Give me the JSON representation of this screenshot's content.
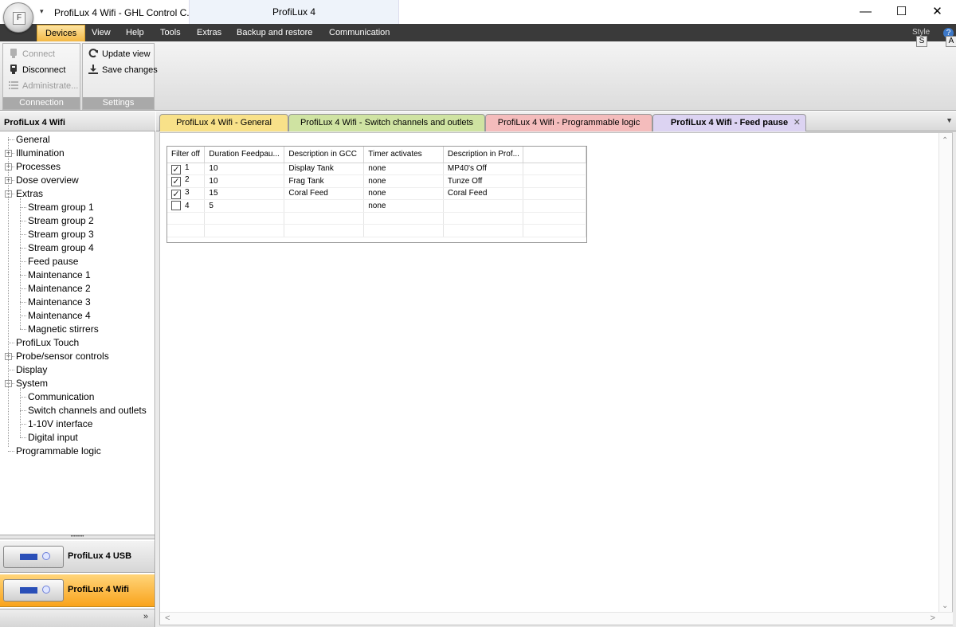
{
  "titlebar": {
    "orb_letter": "F",
    "left_title": "ProfiLux 4 Wifi - GHL Control C...",
    "center_title": "ProfiLux 4",
    "qat_arrow": "▾",
    "minimize": "—",
    "maximize": "☐",
    "close": "✕"
  },
  "menu": {
    "items": [
      "Devices",
      "View",
      "Help",
      "Tools",
      "Extras",
      "Backup and restore",
      "Communication"
    ],
    "active": "Devices",
    "style_label": "Style",
    "style_key": "S",
    "help_glyph": "?",
    "help_key": "A"
  },
  "ribbon": {
    "connection": {
      "label": "Connection",
      "buttons": [
        {
          "label": "Connect",
          "enabled": false,
          "icon": "plug-icon"
        },
        {
          "label": "Disconnect",
          "enabled": true,
          "icon": "unplug-icon"
        },
        {
          "label": "Administrate...",
          "enabled": false,
          "icon": "list-icon"
        }
      ]
    },
    "settings": {
      "label": "Settings",
      "buttons": [
        {
          "label": "Update view",
          "enabled": true,
          "icon": "refresh-icon"
        },
        {
          "label": "Save changes",
          "enabled": true,
          "icon": "download-icon"
        }
      ]
    }
  },
  "left_panel": {
    "title": "ProfiLux 4 Wifi",
    "tree": [
      {
        "label": "General",
        "level": 0,
        "expander": false
      },
      {
        "label": "Illumination",
        "level": 0,
        "expander": true
      },
      {
        "label": "Processes",
        "level": 0,
        "expander": true
      },
      {
        "label": "Dose overview",
        "level": 0,
        "expander": true
      },
      {
        "label": "Extras",
        "level": 0,
        "expander": true,
        "expanded": true
      },
      {
        "label": "Stream group 1",
        "level": 1
      },
      {
        "label": "Stream group 2",
        "level": 1
      },
      {
        "label": "Stream group 3",
        "level": 1
      },
      {
        "label": "Stream group 4",
        "level": 1
      },
      {
        "label": "Feed pause",
        "level": 1
      },
      {
        "label": "Maintenance 1",
        "level": 1
      },
      {
        "label": "Maintenance 2",
        "level": 1
      },
      {
        "label": "Maintenance 3",
        "level": 1
      },
      {
        "label": "Maintenance 4",
        "level": 1
      },
      {
        "label": "Magnetic stirrers",
        "level": 1
      },
      {
        "label": "ProfiLux Touch",
        "level": 0,
        "expander": false
      },
      {
        "label": "Probe/sensor controls",
        "level": 0,
        "expander": true
      },
      {
        "label": "Display",
        "level": 0,
        "expander": false
      },
      {
        "label": "System",
        "level": 0,
        "expander": true,
        "expanded": true
      },
      {
        "label": "Communication",
        "level": 1
      },
      {
        "label": "Switch channels and outlets",
        "level": 1
      },
      {
        "label": "1-10V interface",
        "level": 1
      },
      {
        "label": "Digital input",
        "level": 1
      },
      {
        "label": "Programmable logic",
        "level": 0,
        "expander": false
      }
    ],
    "splitter_dots": "••••••••",
    "devices": [
      {
        "name": "ProfiLux 4 USB",
        "selected": false
      },
      {
        "name": "ProfiLux 4 Wifi",
        "selected": true
      }
    ],
    "more_glyph": "»"
  },
  "doc_tabs": [
    {
      "label": "ProfiLux 4 Wifi - General",
      "color": "#f8e189",
      "active": false
    },
    {
      "label": "ProfiLux 4 Wifi - Switch channels and outlets",
      "color": "#cfe3a2",
      "active": false
    },
    {
      "label": "ProfiLux 4 Wifi - Programmable logic",
      "color": "#f4bcbc",
      "active": false
    },
    {
      "label": "ProfiLux 4 Wifi - Feed pause",
      "color": "#dcd3f2",
      "active": true,
      "close_glyph": "✕"
    }
  ],
  "tabs_dropdown_glyph": "▼",
  "feed_pause_grid": {
    "columns": [
      "Filter off",
      "Duration Feedpau...",
      "Description in GCC",
      "Timer activates",
      "Description in Prof..."
    ],
    "rows": [
      {
        "checked": true,
        "index": "1",
        "duration": "10",
        "desc_gcc": "Display Tank",
        "timer": "none",
        "desc_prof": "MP40's Off"
      },
      {
        "checked": true,
        "index": "2",
        "duration": "10",
        "desc_gcc": "Frag Tank",
        "timer": "none",
        "desc_prof": "Tunze Off"
      },
      {
        "checked": true,
        "index": "3",
        "duration": "15",
        "desc_gcc": "Coral Feed",
        "timer": "none",
        "desc_prof": "Coral Feed"
      },
      {
        "checked": false,
        "index": "4",
        "duration": "5",
        "desc_gcc": "",
        "timer": "none",
        "desc_prof": ""
      }
    ],
    "check_glyph": "✓"
  },
  "scroll_glyphs": {
    "up": "⌃",
    "down": "⌄",
    "left": "<",
    "right": ">"
  }
}
